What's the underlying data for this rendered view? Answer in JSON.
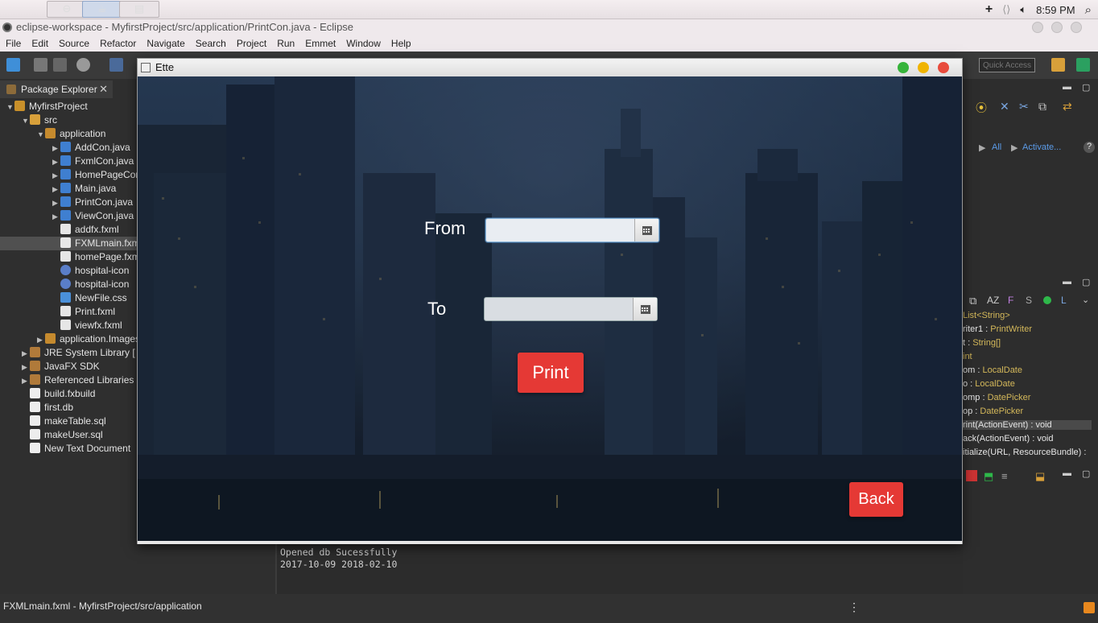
{
  "macbar": {
    "time": "8:59 PM"
  },
  "eclipse": {
    "title": "eclipse-workspace - MyfirstProject/src/application/PrintCon.java - Eclipse",
    "menu": [
      "File",
      "Edit",
      "Source",
      "Refactor",
      "Navigate",
      "Search",
      "Project",
      "Run",
      "Emmet",
      "Window",
      "Help"
    ],
    "quick_access_placeholder": "Quick Access"
  },
  "package_explorer": {
    "tab_label": "Package Explorer",
    "items": [
      {
        "label": "MyfirstProject",
        "icon": "project-icon"
      },
      {
        "label": "src",
        "icon": "source-folder-icon"
      },
      {
        "label": "application",
        "icon": "package-icon"
      },
      {
        "label": "AddCon.java",
        "icon": "java-file-icon"
      },
      {
        "label": "FxmlCon.java",
        "icon": "java-file-icon"
      },
      {
        "label": "HomePageCon.java",
        "icon": "java-file-icon"
      },
      {
        "label": "Main.java",
        "icon": "java-file-icon"
      },
      {
        "label": "PrintCon.java",
        "icon": "java-file-icon"
      },
      {
        "label": "ViewCon.java",
        "icon": "java-file-icon"
      },
      {
        "label": "addfx.fxml",
        "icon": "fxml-file-icon"
      },
      {
        "label": "FXMLmain.fxml",
        "icon": "fxml-file-icon"
      },
      {
        "label": "homePage.fxml",
        "icon": "fxml-file-icon"
      },
      {
        "label": "hospital-icon",
        "icon": "image-file-icon"
      },
      {
        "label": "hospital-icon",
        "icon": "image-file-icon"
      },
      {
        "label": "NewFile.css",
        "icon": "css-file-icon"
      },
      {
        "label": "Print.fxml",
        "icon": "fxml-file-icon"
      },
      {
        "label": "viewfx.fxml",
        "icon": "fxml-file-icon"
      },
      {
        "label": "application.Images",
        "icon": "package-icon"
      },
      {
        "label": "JRE System Library [",
        "icon": "library-icon"
      },
      {
        "label": "JavaFX SDK",
        "icon": "library-icon"
      },
      {
        "label": "Referenced Libraries",
        "icon": "library-icon"
      },
      {
        "label": "build.fxbuild",
        "icon": "file-icon"
      },
      {
        "label": "first.db",
        "icon": "file-icon"
      },
      {
        "label": "makeTable.sql",
        "icon": "file-icon"
      },
      {
        "label": "makeUser.sql",
        "icon": "file-icon"
      },
      {
        "label": "New Text Document",
        "icon": "file-icon"
      }
    ]
  },
  "right_panel": {
    "task_links": [
      "All",
      "Activate..."
    ],
    "outline": [
      {
        "name": "List<String>",
        "type": ""
      },
      {
        "name": "riter1 : ",
        "type": "PrintWriter"
      },
      {
        "name": "t : ",
        "type": "String[]"
      },
      {
        "name": "",
        "type": "int"
      },
      {
        "name": "om : ",
        "type": "LocalDate"
      },
      {
        "name": "o : ",
        "type": "LocalDate"
      },
      {
        "name": "omp : ",
        "type": "DatePicker"
      },
      {
        "name": "op : ",
        "type": "DatePicker"
      },
      {
        "name": "rint(ActionEvent) : void",
        "type": ""
      },
      {
        "name": "ack(ActionEvent) : void",
        "type": ""
      },
      {
        "name": "itialize(URL, ResourceBundle) : ",
        "type": ""
      }
    ]
  },
  "console": {
    "lines": [
      "Opened db Sucessfully",
      "2017-10-09  2018-02-10"
    ]
  },
  "status": {
    "text": "FXMLmain.fxml - MyfirstProject/src/application"
  },
  "fx_window": {
    "title": "Ette",
    "from_label": "From",
    "to_label": "To",
    "from_value": "",
    "to_value": "",
    "print_label": "Print",
    "back_label": "Back",
    "accent": "#e53935"
  }
}
